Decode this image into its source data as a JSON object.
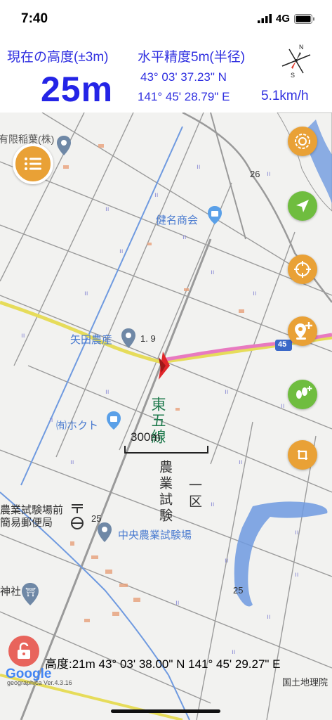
{
  "status_bar": {
    "time": "7:40",
    "network": "4G"
  },
  "header": {
    "altitude_label": "現在の高度(±3m)",
    "altitude_value": "25m",
    "accuracy_label": "水平精度5m(半径)",
    "latitude": "43° 03' 37.23\" N",
    "longitude": "141° 45' 28.79\" E",
    "speed": "5.1km/h",
    "compass_letters": {
      "north": "N",
      "south": "S"
    }
  },
  "map": {
    "poi_labels": {
      "kenmei": "健名商会",
      "yada": "矢田農産",
      "hokuto": "㈲ホクト",
      "experiment_station": "中央農業試験場",
      "post_office_1": "農業試験場前",
      "post_office_2": "簡易郵便局",
      "shrine": "神社",
      "partial_top": "有限稲葉(株)"
    },
    "area_labels": {
      "higashi_gosen": "東五線",
      "nogyo_shiken": "農業試験",
      "ichiku": "一区"
    },
    "elevation_marks": [
      "26",
      "1. 9",
      "25",
      "25"
    ],
    "route_number": "45",
    "scale": "300m",
    "colors": {
      "route_pink": "#e87ac0",
      "road_yellow": "#e6dc5a",
      "water_blue": "#6f9ae0",
      "poi_blue": "#4a7bd0",
      "fab_orange": "#e9a136",
      "fab_green": "#6fbd3f",
      "lock_red": "#e8645c"
    }
  },
  "buttons": {
    "menu": "list-icon",
    "map_style": "swirl-icon",
    "navigate": "arrow-icon",
    "locate": "crosshair-icon",
    "add_place": "add-pin-icon",
    "footprints": "footprint-icon",
    "rotate": "rotate-icon",
    "lock": "unlock-icon"
  },
  "bottom": {
    "readout": "高度:21m  43° 03' 38.00\" N 141° 45' 29.27\" E",
    "gsi_credit": "国土地理院",
    "google": "Google",
    "google_sub": "geographica Ver.4.3.16"
  }
}
